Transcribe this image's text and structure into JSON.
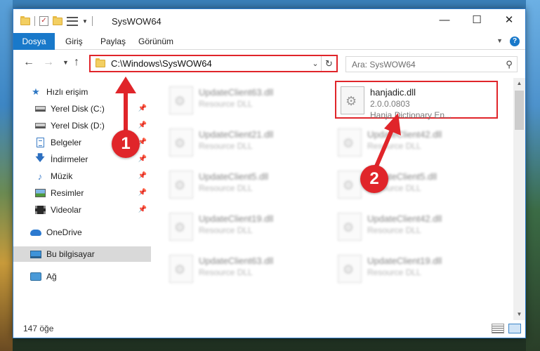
{
  "window": {
    "title": "SysWOW64"
  },
  "title_controls": {
    "minimize": "—",
    "maximize": "☐",
    "close": "✕"
  },
  "ribbon": {
    "tabs": [
      {
        "label": "Dosya",
        "active": true
      },
      {
        "label": "Giriş"
      },
      {
        "label": "Paylaş"
      },
      {
        "label": "Görünüm"
      }
    ],
    "help": "?"
  },
  "address_bar": {
    "path": "C:\\Windows\\SysWOW64"
  },
  "search": {
    "placeholder": "Ara: SysWOW64"
  },
  "sidebar": {
    "items": [
      {
        "label": "Hızlı erişim",
        "icon": "star-icon"
      },
      {
        "label": "Yerel Disk (C:)",
        "icon": "drive-icon",
        "pinned": true
      },
      {
        "label": "Yerel Disk (D:)",
        "icon": "drive-icon",
        "pinned": true
      },
      {
        "label": "Belgeler",
        "icon": "documents-icon",
        "pinned": true
      },
      {
        "label": "İndirmeler",
        "icon": "downloads-icon",
        "pinned": true
      },
      {
        "label": "Müzik",
        "icon": "music-icon",
        "pinned": true
      },
      {
        "label": "Resimler",
        "icon": "pictures-icon",
        "pinned": true
      },
      {
        "label": "Videolar",
        "icon": "videos-icon",
        "pinned": true
      },
      {
        "label": "OneDrive",
        "icon": "onedrive-icon"
      },
      {
        "label": "Bu bilgisayar",
        "icon": "this-pc-icon",
        "selected": true
      },
      {
        "label": "Ağ",
        "icon": "network-icon"
      }
    ]
  },
  "files": [
    {
      "name": "UpdateClient63.dll",
      "type": "Resource DLL"
    },
    {
      "name": "hanjadic.dll",
      "version": "2.0.0.0803",
      "description": "Hanja Dictionary En..."
    },
    {
      "name": "UpdateClient21.dll",
      "type": "Resource DLL"
    },
    {
      "name": "UpdateClient42.dll",
      "type": "Resource DLL"
    },
    {
      "name": "UpdateClient5.dll",
      "type": "Resource DLL"
    },
    {
      "name": "UpdateClient5.dll",
      "type": "Resource DLL"
    },
    {
      "name": "UpdateClient19.dll",
      "type": "Resource DLL"
    },
    {
      "name": "UpdateClient42.dll",
      "type": "Resource DLL"
    },
    {
      "name": "UpdateClient63.dll",
      "type": "Resource DLL"
    },
    {
      "name": "UpdateClient19.dll",
      "type": "Resource DLL"
    }
  ],
  "status": {
    "count": "147 öğe"
  },
  "annotations": {
    "one": "1",
    "two": "2"
  },
  "colors": {
    "accent": "#1979ca",
    "highlight": "#e0252a",
    "selected_bg": "#d9d9d9"
  }
}
